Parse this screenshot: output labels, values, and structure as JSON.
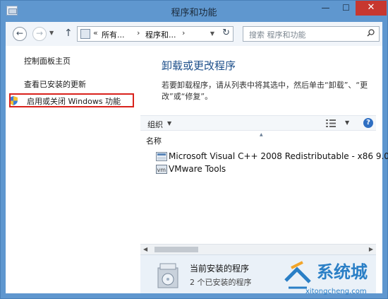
{
  "window": {
    "title": "程序和功能",
    "controls": {
      "minimize": "—",
      "maximize": "☐",
      "close": "✕"
    }
  },
  "address_bar": {
    "separator": "«",
    "segments": [
      "所有...",
      "程序和..."
    ],
    "chevron": "›",
    "search_placeholder": "搜索 程序和功能"
  },
  "left_pane": {
    "home_link": "控制面板主页",
    "updates_link": "查看已安装的更新",
    "features_link": "启用或关闭 Windows 功能"
  },
  "main": {
    "heading": "卸载或更改程序",
    "description": "若要卸载程序，请从列表中将其选中，然后单击“卸载”、“更改”或“修复”。",
    "toolbar": {
      "organize": "组织"
    },
    "column_header": "名称",
    "programs": [
      {
        "name": "Microsoft Visual C++ 2008 Redistributable - x86 9.0...",
        "icon": "vc-redist-icon"
      },
      {
        "name": "VMware Tools",
        "icon": "vmware-icon"
      }
    ],
    "details": {
      "title": "当前安装的程序",
      "count": "2 个已安装的程序"
    }
  },
  "watermark": {
    "brand": "系统城",
    "url": "xitongcheng.com"
  },
  "colors": {
    "title_bar": "#5f97cf",
    "heading": "#1d4f8a",
    "highlight_border": "#d9221c",
    "details_bg": "#eaf1f8",
    "watermark": "#2a7fc6"
  }
}
